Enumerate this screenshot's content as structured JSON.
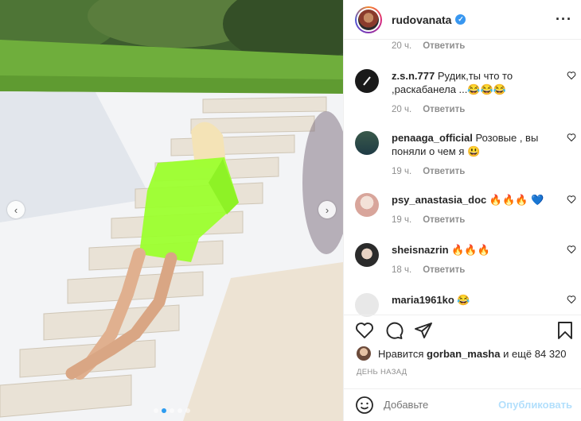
{
  "post": {
    "username": "rudovanata",
    "more_icon": "more-horizontal-icon"
  },
  "carousel": {
    "dots_count": 5,
    "active_dot": 1
  },
  "reply_label": "Ответить",
  "first_comment_time": "20 ч.",
  "comments": [
    {
      "user": "z.s.n.777",
      "text": "Рудик,ты что то ,раскабанела ...😂😂😂",
      "time": "20 ч."
    },
    {
      "user": "penaaga_official",
      "text": "Розовые , вы поняли о чем я 😃",
      "time": "19 ч."
    },
    {
      "user": "psy_anastasia_doc",
      "text": "🔥🔥🔥 💙",
      "time": "19 ч."
    },
    {
      "user": "sheisnazrin",
      "text": "🔥🔥🔥",
      "time": "18 ч."
    },
    {
      "user": "maria1961ko",
      "text": "😂",
      "time": ""
    }
  ],
  "likes": {
    "prefix": "Нравится",
    "user": "gorban_masha",
    "suffix": "и ещё 84 320"
  },
  "date_label": "ДЕНЬ НАЗАД",
  "add_comment": {
    "placeholder": "Добавьте",
    "publish_label": "Опубликовать"
  },
  "colors": {
    "accent": "#3897f0",
    "publish_disabled": "#b2dffc",
    "dress": "#9cff2e"
  }
}
